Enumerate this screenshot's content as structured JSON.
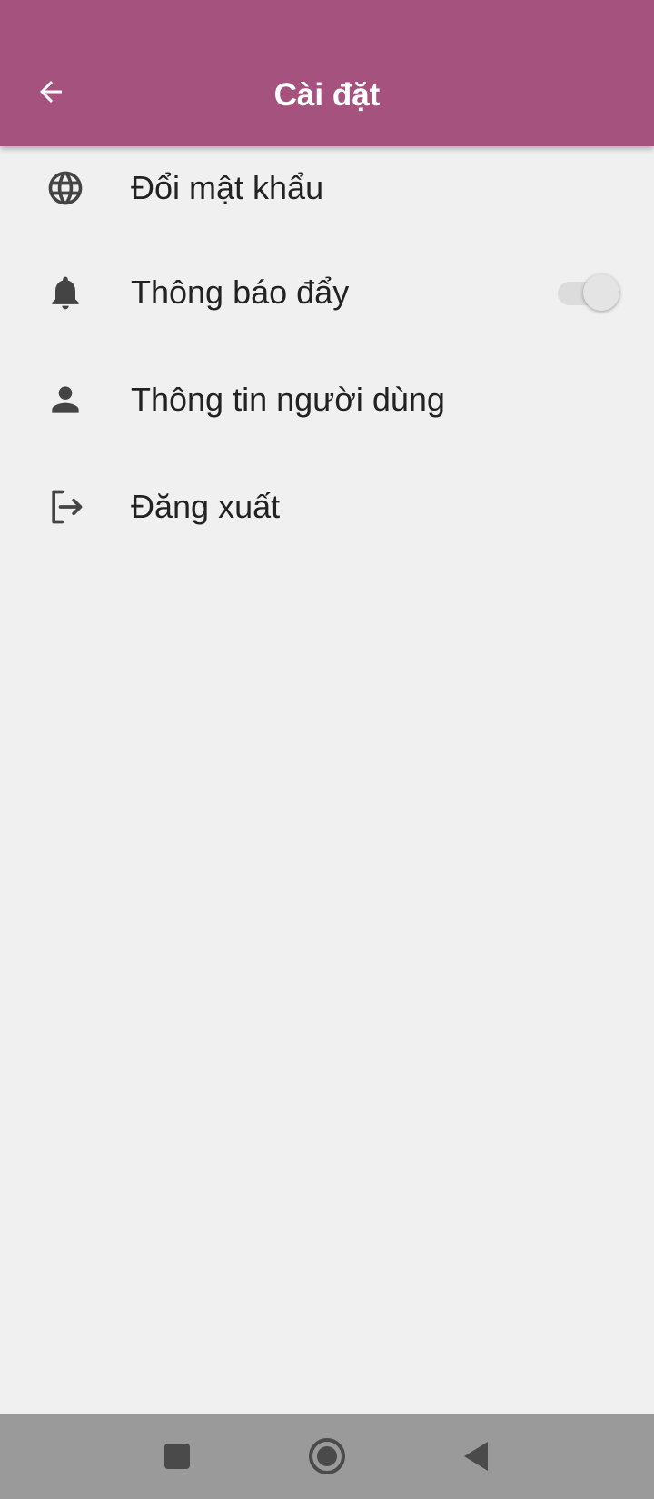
{
  "app_bar": {
    "title": "Cài đặt",
    "back_icon": "arrow-left-icon",
    "background_color": "#a5527e"
  },
  "settings": {
    "items": [
      {
        "label": "Đổi mật khẩu",
        "icon": "globe-icon"
      },
      {
        "label": "Thông báo đẩy",
        "icon": "bell-icon",
        "toggle_on": false
      },
      {
        "label": "Thông tin người dùng",
        "icon": "person-icon"
      },
      {
        "label": "Đăng xuất",
        "icon": "logout-icon"
      }
    ]
  },
  "system_nav": {
    "buttons": [
      "recents-square-icon",
      "home-circle-icon",
      "back-triangle-icon"
    ],
    "background_color": "#9a9a9a"
  }
}
